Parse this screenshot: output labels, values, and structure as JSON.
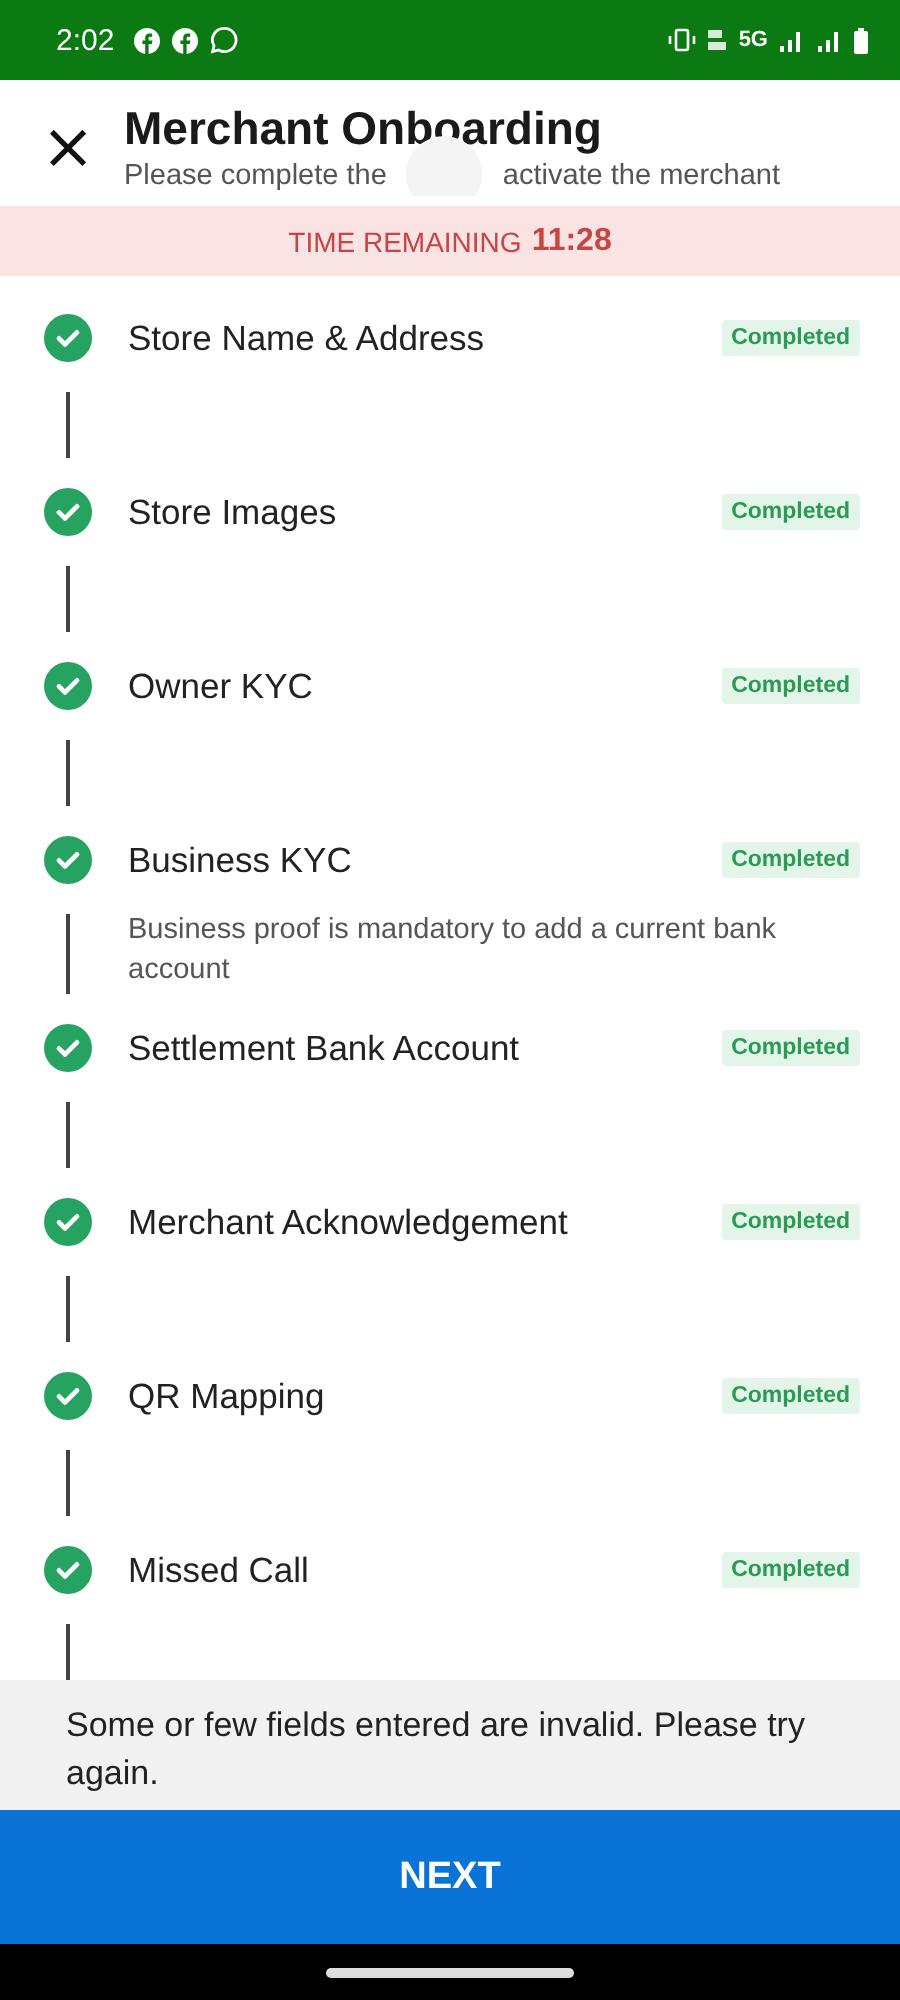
{
  "status_bar": {
    "time": "2:02",
    "network": "5G"
  },
  "header": {
    "close": "×",
    "title": "Merchant Onboarding",
    "subtitle_parts": [
      "Please complete the",
      "activate the merchant"
    ]
  },
  "timer": {
    "label": "TIME REMAINING",
    "value": "11:28"
  },
  "steps": [
    {
      "title": "Store Name & Address",
      "status": "Completed",
      "done": true
    },
    {
      "title": "Store Images",
      "status": "Completed",
      "done": true
    },
    {
      "title": "Owner KYC",
      "status": "Completed",
      "done": true
    },
    {
      "title": "Business KYC",
      "status": "Completed",
      "done": true,
      "note": "Business proof is mandatory to add a current bank account"
    },
    {
      "title": "Settlement Bank Account",
      "status": "Completed",
      "done": true
    },
    {
      "title": "Merchant Acknowledgement",
      "status": "Completed",
      "done": true
    },
    {
      "title": "QR Mapping",
      "status": "Completed",
      "done": true
    },
    {
      "title": "Missed Call",
      "status": "Completed",
      "done": true
    }
  ],
  "error_message": "Some or few fields entered are invalid. Please try again.",
  "next_button": "NEXT"
}
